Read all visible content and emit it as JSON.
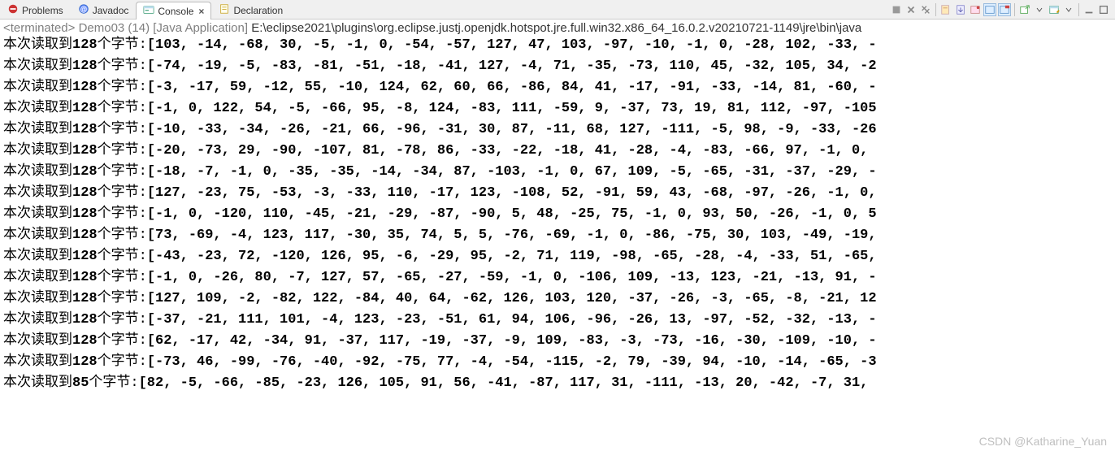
{
  "tabs": {
    "problems": "Problems",
    "javadoc": "Javadoc",
    "console": "Console",
    "declaration": "Declaration"
  },
  "status": {
    "terminated": "<terminated>",
    "app": "Demo03 (14) [Java Application]",
    "path": "E:\\eclipse2021\\plugins\\org.eclipse.justj.openjdk.hotspot.jre.full.win32.x86_64_16.0.2.v20210721-1149\\jre\\bin\\java"
  },
  "prefix": {
    "before": "本次读取到",
    "after": "个字节:"
  },
  "lines": [
    {
      "n": "128",
      "v": "[103, -14, -68, 30, -5, -1, 0, -54, -57, 127, 47, 103, -97, -10, -1, 0, -28, 102, -33, -"
    },
    {
      "n": "128",
      "v": "[-74, -19, -5, -83, -81, -51, -18, -41, 127, -4, 71, -35, -73, 110, 45, -32, 105, 34, -2"
    },
    {
      "n": "128",
      "v": "[-3, -17, 59, -12, 55, -10, 124, 62, 60, 66, -86, 84, 41, -17, -91, -33, -14, 81, -60, -"
    },
    {
      "n": "128",
      "v": "[-1, 0, 122, 54, -5, -66, 95, -8, 124, -83, 111, -59, 9, -37, 73, 19, 81, 112, -97, -105"
    },
    {
      "n": "128",
      "v": "[-10, -33, -34, -26, -21, 66, -96, -31, 30, 87, -11, 68, 127, -111, -5, 98, -9, -33, -26"
    },
    {
      "n": "128",
      "v": "[-20, -73, 29, -90, -107, 81, -78, 86, -33, -22, -18, 41, -28, -4, -83, -66, 97, -1, 0, "
    },
    {
      "n": "128",
      "v": "[-18, -7, -1, 0, -35, -35, -14, -34, 87, -103, -1, 0, 67, 109, -5, -65, -31, -37, -29, -"
    },
    {
      "n": "128",
      "v": "[127, -23, 75, -53, -3, -33, 110, -17, 123, -108, 52, -91, 59, 43, -68, -97, -26, -1, 0,"
    },
    {
      "n": "128",
      "v": "[-1, 0, -120, 110, -45, -21, -29, -87, -90, 5, 48, -25, 75, -1, 0, 93, 50, -26, -1, 0, 5"
    },
    {
      "n": "128",
      "v": "[73, -69, -4, 123, 117, -30, 35, 74, 5, 5, -76, -69, -1, 0, -86, -75, 30, 103, -49, -19,"
    },
    {
      "n": "128",
      "v": "[-43, -23, 72, -120, 126, 95, -6, -29, 95, -2, 71, 119, -98, -65, -28, -4, -33, 51, -65,"
    },
    {
      "n": "128",
      "v": "[-1, 0, -26, 80, -7, 127, 57, -65, -27, -59, -1, 0, -106, 109, -13, 123, -21, -13, 91, -"
    },
    {
      "n": "128",
      "v": "[127, 109, -2, -82, 122, -84, 40, 64, -62, 126, 103, 120, -37, -26, -3, -65, -8, -21, 12"
    },
    {
      "n": "128",
      "v": "[-37, -21, 111, 101, -4, 123, -23, -51, 61, 94, 106, -96, -26, 13, -97, -52, -32, -13, -"
    },
    {
      "n": "128",
      "v": "[62, -17, 42, -34, 91, -37, 117, -19, -37, -9, 109, -83, -3, -73, -16, -30, -109, -10, -"
    },
    {
      "n": "128",
      "v": "[-73, 46, -99, -76, -40, -92, -75, 77, -4, -54, -115, -2, 79, -39, 94, -10, -14, -65, -3"
    },
    {
      "n": "85",
      "v": "[82, -5, -66, -85, -23, 126, 105, 91, 56, -41, -87, 117, 31, -111, -13, 20, -42, -7, 31,"
    }
  ],
  "watermark": "CSDN @Katharine_Yuan"
}
